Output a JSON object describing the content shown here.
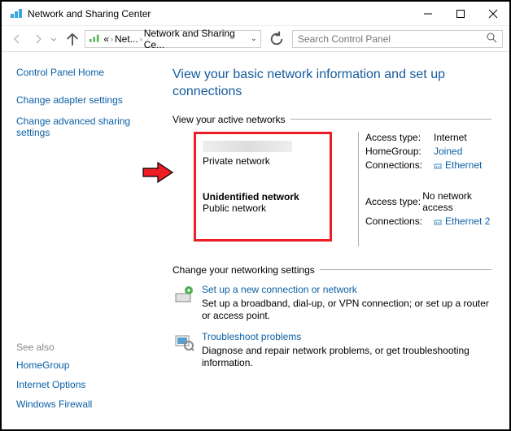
{
  "titlebar": {
    "title": "Network and Sharing Center"
  },
  "toolbar": {
    "breadcrumb": {
      "item1": "Net...",
      "item2": "Network and Sharing Ce..."
    },
    "search_placeholder": "Search Control Panel"
  },
  "sidebar": {
    "cp_home": "Control Panel Home",
    "links": [
      {
        "label": "Change adapter settings"
      },
      {
        "label": "Change advanced sharing settings"
      }
    ],
    "see_also_hdr": "See also",
    "see_also": [
      {
        "label": "HomeGroup"
      },
      {
        "label": "Internet Options"
      },
      {
        "label": "Windows Firewall"
      }
    ]
  },
  "main": {
    "heading": "View your basic network information and set up connections",
    "active_hdr": "View your active networks",
    "networks": {
      "net1": {
        "type": "Private network"
      },
      "net2": {
        "title": "Unidentified network",
        "type": "Public network"
      }
    },
    "details1": {
      "access_label": "Access type:",
      "access_val": "Internet",
      "hg_label": "HomeGroup:",
      "hg_val": "Joined",
      "conn_label": "Connections:",
      "conn_val": "Ethernet"
    },
    "details2": {
      "access_label": "Access type:",
      "access_val": "No network access",
      "conn_label": "Connections:",
      "conn_val": "Ethernet 2"
    },
    "change_hdr": "Change your networking settings",
    "settings": [
      {
        "title": "Set up a new connection or network",
        "desc": "Set up a broadband, dial-up, or VPN connection; or set up a router or access point."
      },
      {
        "title": "Troubleshoot problems",
        "desc": "Diagnose and repair network problems, or get troubleshooting information."
      }
    ]
  }
}
